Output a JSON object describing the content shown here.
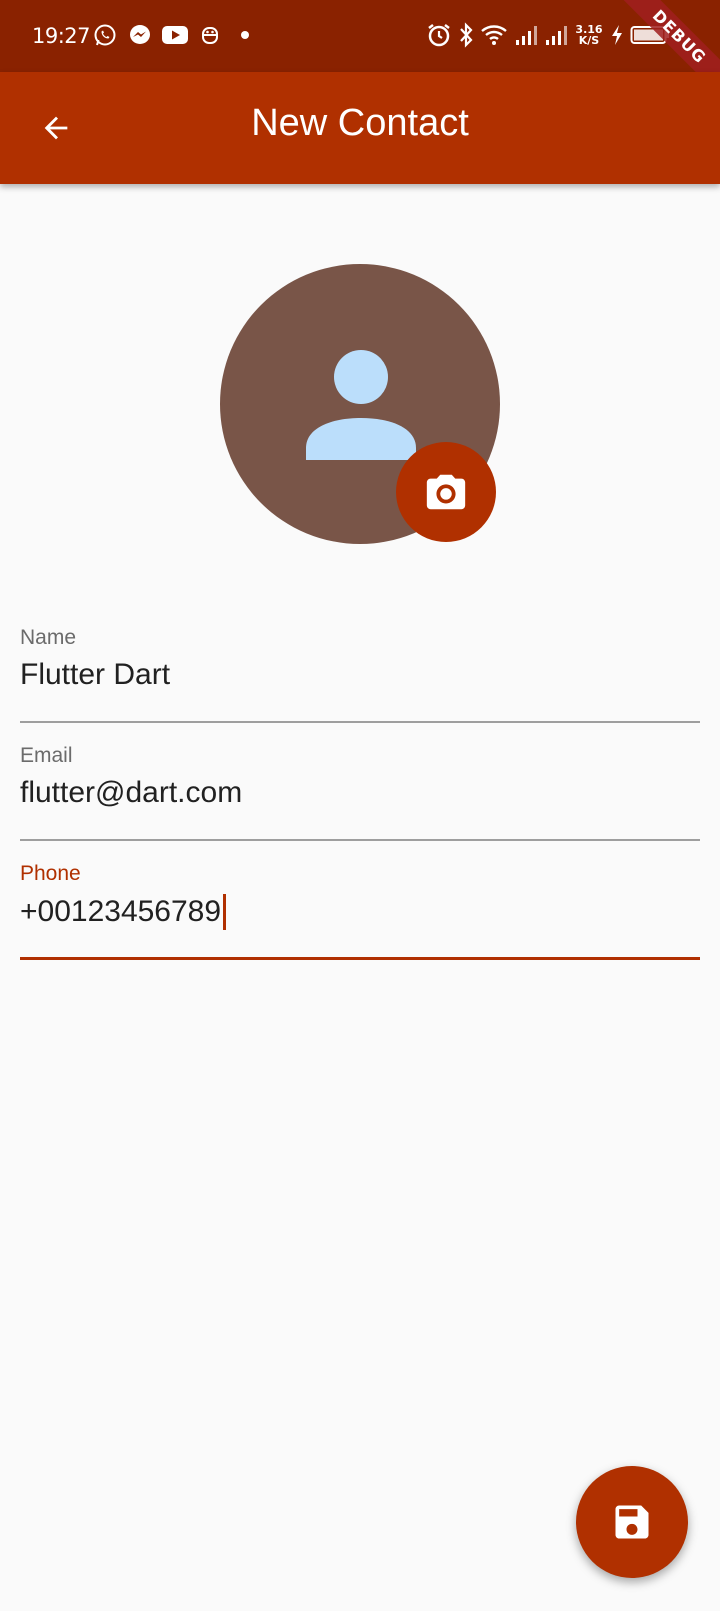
{
  "status_bar": {
    "time": "19:27",
    "left_icons": [
      "whatsapp-icon",
      "messenger-icon",
      "youtube-icon",
      "robot-icon",
      "dot-icon"
    ],
    "right_icons": [
      "alarm-icon",
      "bluetooth-icon",
      "wifi-icon",
      "signal-icon",
      "signal-icon",
      "charging-icon",
      "battery-icon"
    ],
    "net_speed_value": "3.16",
    "net_speed_unit": "K/S",
    "debug_label": "DEBUG"
  },
  "app_bar": {
    "title": "New Contact",
    "back_icon": "arrow-back-icon"
  },
  "avatar": {
    "icon": "person-icon",
    "background": "#795548",
    "icon_color": "#bbdefb",
    "camera_icon": "camera-icon"
  },
  "form": {
    "name": {
      "label": "Name",
      "value": "Flutter Dart"
    },
    "email": {
      "label": "Email",
      "value": "flutter@dart.com"
    },
    "phone": {
      "label": "Phone",
      "value": "+00123456789",
      "focused": true
    }
  },
  "fab": {
    "icon": "save-icon"
  },
  "colors": {
    "primary": "#b03000",
    "status_bar": "#8a2200",
    "background": "#fafafa"
  }
}
